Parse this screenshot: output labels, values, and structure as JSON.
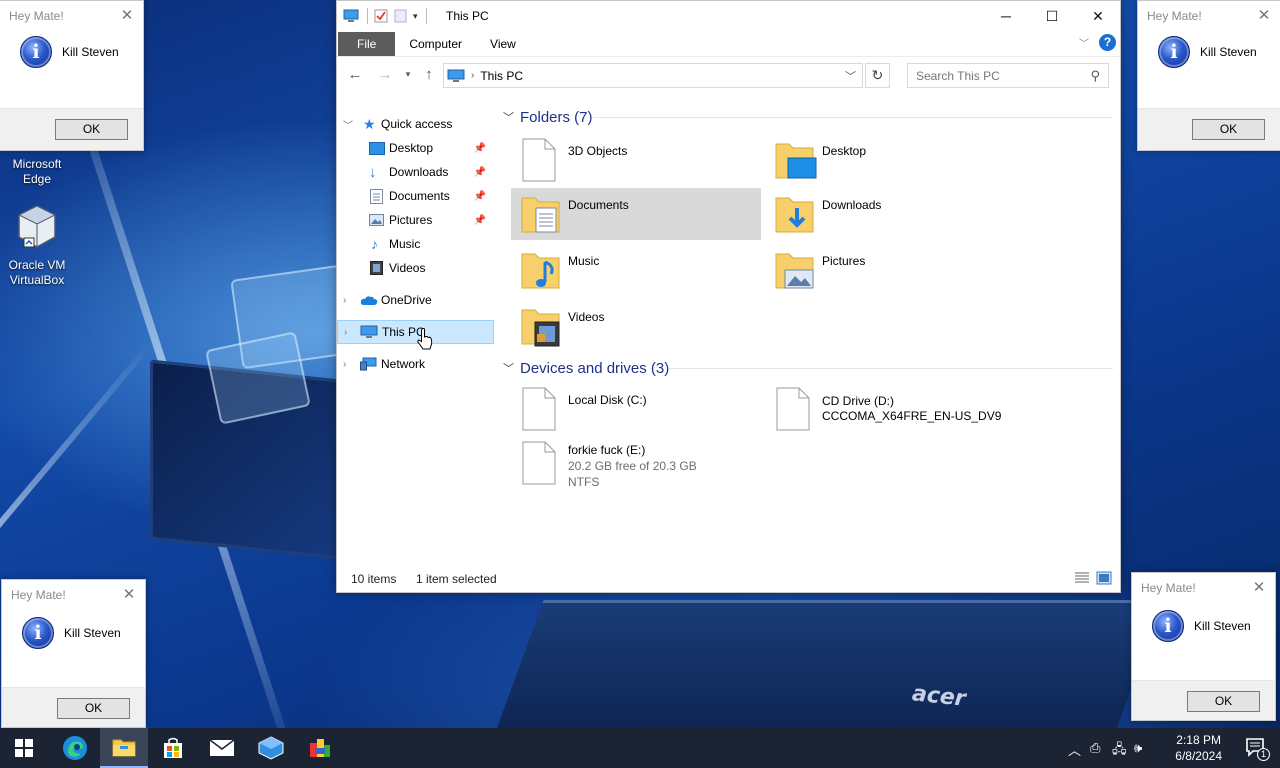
{
  "desktop": {
    "icons": [
      {
        "label_line1": "Microsoft",
        "label_line2": "Edge"
      },
      {
        "label_line1": "Oracle VM",
        "label_line2": "VirtualBox"
      }
    ],
    "wallpaper_brand": "acer"
  },
  "message_boxes": [
    {
      "title": "Hey Mate!",
      "message": "Kill Steven",
      "ok": "OK"
    },
    {
      "title": "Hey Mate!",
      "message": "Kill Steven",
      "ok": "OK"
    },
    {
      "title": "Hey Mate!",
      "message": "Kill Steven",
      "ok": "OK"
    },
    {
      "title": "Hey Mate!",
      "message": "Kill Steven",
      "ok": "OK"
    }
  ],
  "explorer": {
    "title": "This PC",
    "ribbon_tabs": [
      "File",
      "Computer",
      "View"
    ],
    "address_path": "This PC",
    "search_placeholder": "Search This PC",
    "nav": {
      "quick_access": "Quick access",
      "quick_items": [
        {
          "label": "Desktop",
          "pinned": true
        },
        {
          "label": "Downloads",
          "pinned": true
        },
        {
          "label": "Documents",
          "pinned": true
        },
        {
          "label": "Pictures",
          "pinned": true
        },
        {
          "label": "Music",
          "pinned": false
        },
        {
          "label": "Videos",
          "pinned": false
        }
      ],
      "onedrive": "OneDrive",
      "this_pc": "This PC",
      "network": "Network"
    },
    "folders_header": "Folders (7)",
    "folders": [
      {
        "name": "3D Objects"
      },
      {
        "name": "Desktop"
      },
      {
        "name": "Documents"
      },
      {
        "name": "Downloads"
      },
      {
        "name": "Music"
      },
      {
        "name": "Pictures"
      },
      {
        "name": "Videos"
      }
    ],
    "devices_header": "Devices and drives (3)",
    "drives": [
      {
        "name": "Local Disk (C:)"
      },
      {
        "name": "CD Drive (D:)",
        "line2": "CCCOMA_X64FRE_EN-US_DV9"
      },
      {
        "name": "forkie fuck (E:)",
        "free": "20.2 GB free of 20.3 GB",
        "fs": "NTFS"
      }
    ],
    "status": {
      "items": "10 items",
      "selected": "1 item selected"
    }
  },
  "taskbar": {
    "time": "2:18 PM",
    "date": "6/8/2024",
    "notification_count": "1"
  },
  "colors": {
    "selection": "#cce8ff",
    "tile_selected": "#d9d9d9",
    "group_header": "#1e3287",
    "taskbar": "#1c2433"
  }
}
